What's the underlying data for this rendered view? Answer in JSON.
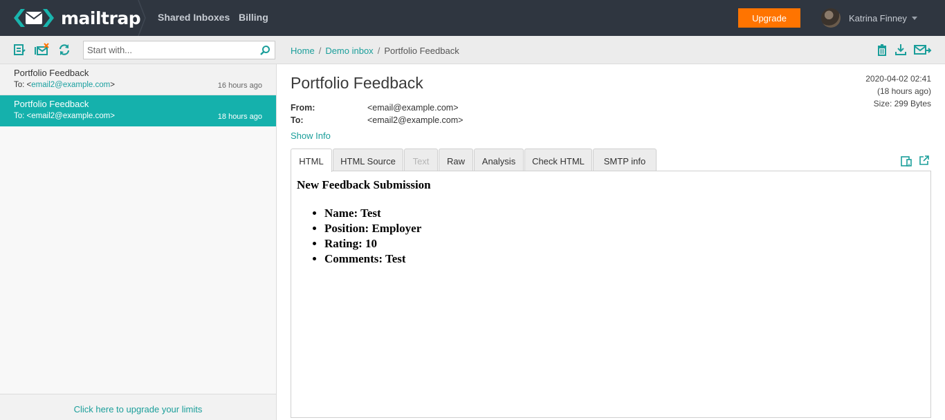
{
  "app": {
    "brand": "mailtrap",
    "nav": [
      "Shared Inboxes",
      "Billing"
    ],
    "upgrade_label": "Upgrade",
    "user_name": "Katrina Finney",
    "colors": {
      "topbar": "#2f3640",
      "accent": "#15b1ac",
      "upgrade": "#ff7400"
    }
  },
  "sidebar": {
    "search_placeholder": "Start with...",
    "messages": [
      {
        "subject": "Portfolio Feedback",
        "to_prefix": "To: ",
        "to_open": "<",
        "to_email": "email2@example.com",
        "to_close": ">",
        "time": "16 hours ago"
      },
      {
        "subject": "Portfolio Feedback",
        "to_prefix": "To: ",
        "to_open": "<",
        "to_email": "email2@example.com",
        "to_close": ">",
        "time": "18 hours ago",
        "selected": true
      }
    ],
    "footer_link": "Click here to upgrade your limits"
  },
  "main": {
    "breadcrumb": [
      "Home",
      "Demo inbox",
      "Portfolio Feedback"
    ],
    "breadcrumb_sep": "/",
    "title": "Portfolio Feedback",
    "from_label": "From:",
    "from_value": "<email@example.com>",
    "to_label": "To:",
    "to_value": "<email2@example.com>",
    "date": "2020-04-02 02:41",
    "relative": "(18 hours ago)",
    "size": "Size: 299 Bytes",
    "show_info": "Show Info",
    "tabs": [
      "HTML",
      "HTML Source",
      "Text",
      "Raw",
      "Analysis",
      "Check HTML",
      "SMTP info"
    ],
    "active_tab": "HTML",
    "disabled_tab": "Text",
    "body": {
      "heading": "New Feedback Submission",
      "items": [
        "Name: Test",
        "Position: Employer",
        "Rating: 10",
        "Comments: Test"
      ]
    }
  }
}
